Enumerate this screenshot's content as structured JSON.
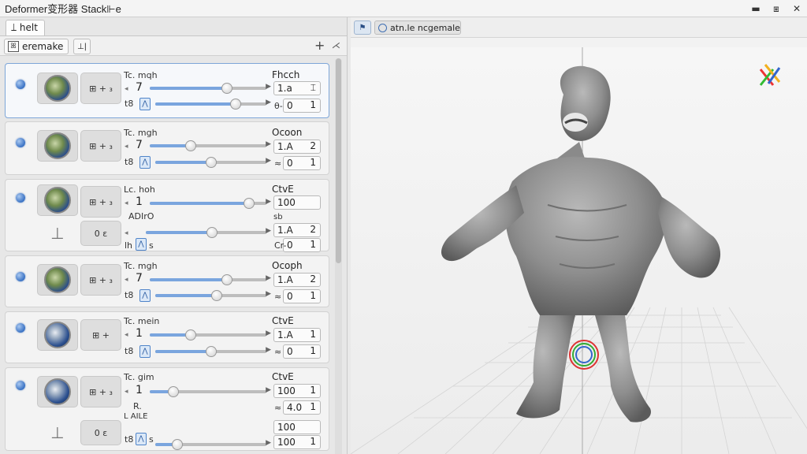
{
  "window": {
    "title": "Deformer变形器 Stack⊩e",
    "close": "✕"
  },
  "left_panel": {
    "tab": "⟘ helt",
    "active_tab": "eremake",
    "active_tab_icon": "ꕤ",
    "secondary_tab": "⊥|",
    "add": "+",
    "pin": "⋌"
  },
  "deformers": [
    {
      "ball": "light",
      "mini": "⊞ + ₃",
      "label": "Tc. mqh",
      "value": "7",
      "t_label": "t8",
      "right_label": "Fhcch",
      "field1": "1.a",
      "field2": "0",
      "field2_prefix": "θ-",
      "field2_suffix": "1",
      "top_slider": 0.66,
      "bottom_slider": 0.72
    },
    {
      "ball": "light",
      "mini": "⊞ + ₃",
      "label": "Tc. mgh",
      "value": "7",
      "t_label": "t8",
      "right_label": "Ocoon",
      "field1": "1.A",
      "field2": "0",
      "field2_prefix": "≈",
      "field2_suffix": "1",
      "top_slider": 0.35,
      "bottom_slider": 0.5
    },
    {
      "ball": "light",
      "mini": "⊞ + ₃",
      "label": "Lc. hoh",
      "value": "1",
      "t_label": "lh",
      "right_label": "CtvE",
      "field1": "100",
      "field1_prefix": "sb",
      "sub_label": "ADIrO",
      "handle_mini": "0 ε",
      "field2": "1.A",
      "field2_suffix": "2",
      "field3": "0",
      "field3_prefix": "Cr-",
      "field3_suffix": "1",
      "extra_t": "s",
      "top_slider": 0.85,
      "mid_slider": 0.55
    },
    {
      "ball": "light",
      "mini": "⊞ + ₃",
      "label": "Tc. mgh",
      "value": "7",
      "t_label": "t8",
      "right_label": "Ocoph",
      "field1": "1.A",
      "field1_suffix": "2",
      "field2": "0",
      "field2_prefix": "≈",
      "field2_suffix": "1",
      "top_slider": 0.66,
      "bottom_slider": 0.55
    },
    {
      "ball": "dark",
      "mini": "⊞ +",
      "label": "Tc. mein",
      "value": "1",
      "t_label": "t8",
      "right_label": "CtvE",
      "field1": "1.A",
      "field1_suffix": "1",
      "field2": "0",
      "field2_prefix": "≈",
      "field2_suffix": "1",
      "top_slider": 0.35,
      "bottom_slider": 0.5
    },
    {
      "ball": "dark",
      "mini": "⊞ + ₃",
      "label": "Tc. gim",
      "value": "1",
      "t_label": "t8",
      "right_label": "CtvE",
      "field1": "100",
      "field1_suffix": "1",
      "sub_label": "R.",
      "sub_label2": "L AILE",
      "handle_mini": "0 ε",
      "field2": "4.0",
      "field2_prefix": "≈",
      "field2_suffix": "1",
      "field3": "100",
      "field3_suffix": "1",
      "extra_t": "s",
      "top_slider": 0.2,
      "bottom_slider": 0.2
    }
  ],
  "viewport": {
    "tab_icon": "⚑",
    "tab_label": "atn.le ncgemale"
  }
}
